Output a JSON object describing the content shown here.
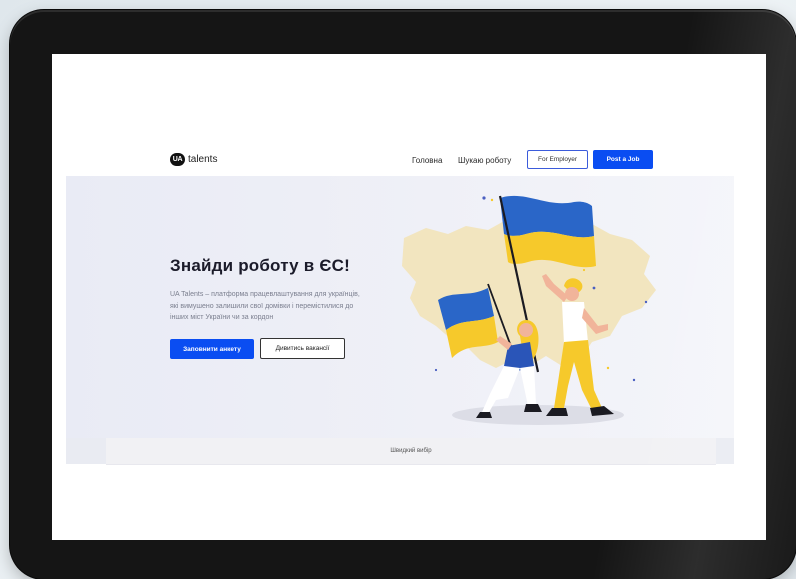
{
  "header": {
    "logo_badge": "UA",
    "logo_text": "talents",
    "nav": [
      {
        "label": "Головна"
      },
      {
        "label": "Шукаю роботу"
      }
    ],
    "for_employer_label": "For Employer",
    "post_job_label": "Post a Job"
  },
  "hero": {
    "title": "Знайди роботу в ЄС!",
    "description": "UA Talents – платформа працевлаштування для українців, які вимушено залишили свої домівки і перемістилися до інших міст України чи за кордон",
    "primary_button": "Заповнити анкету",
    "secondary_button": "Дивитись вакансії"
  },
  "quick_select": {
    "label": "Швидкий вибір"
  },
  "colors": {
    "accent_blue": "#0a4df2",
    "flag_blue": "#2a66c8",
    "flag_yellow": "#f6c92b",
    "map_fill": "#f2e3b8"
  }
}
